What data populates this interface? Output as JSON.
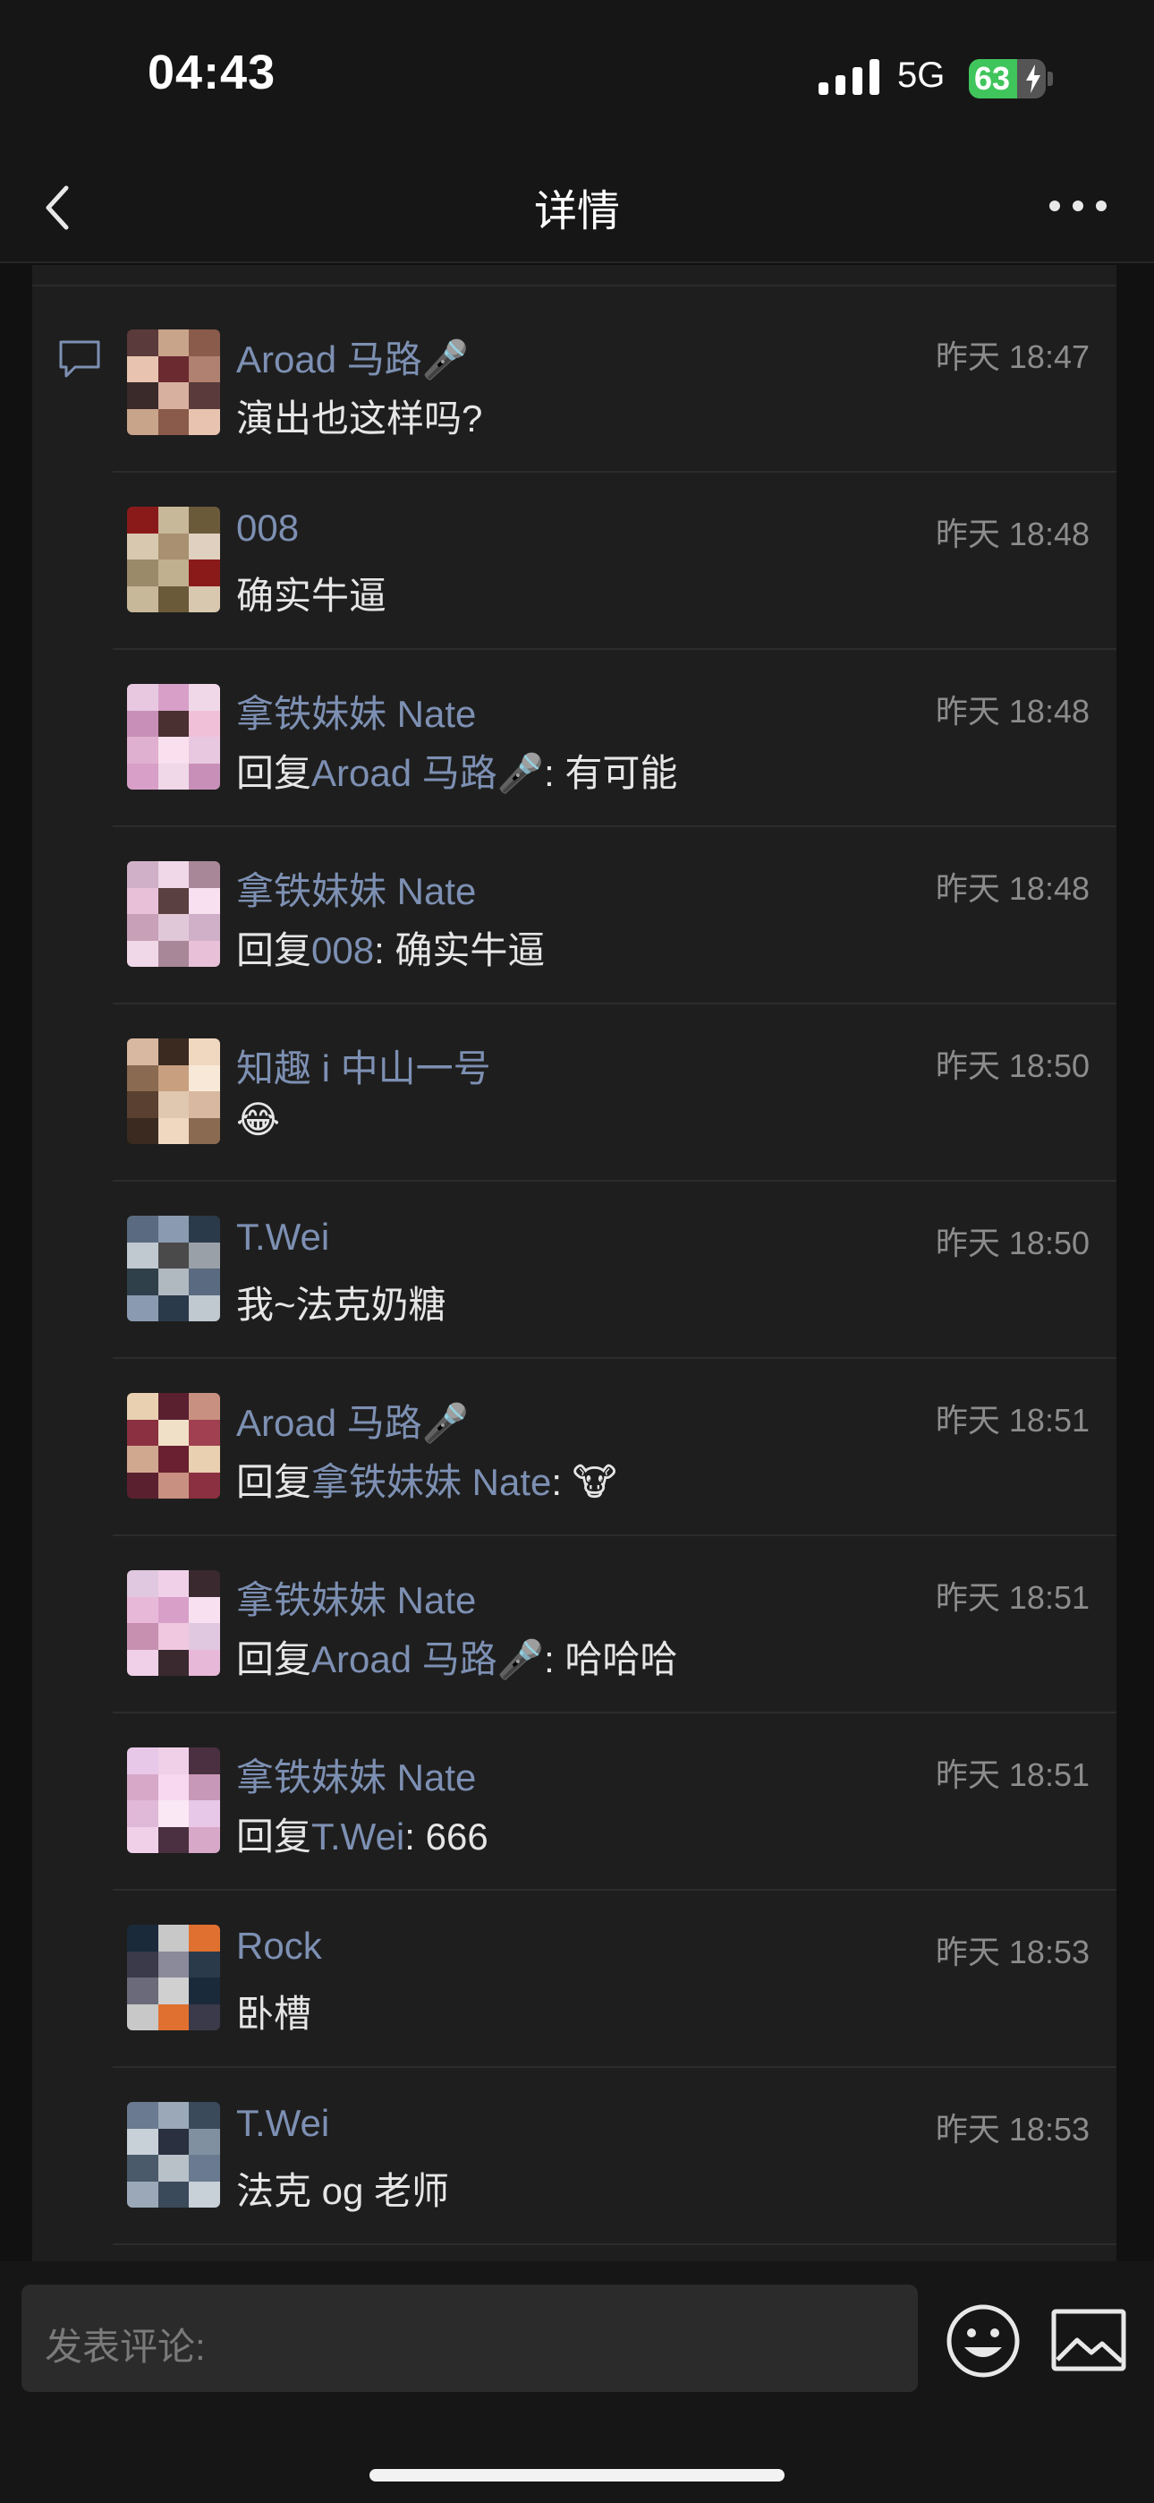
{
  "status_bar": {
    "time": "04:43",
    "network": "5G",
    "battery": "63",
    "battery_level": 0.63
  },
  "nav": {
    "title": "详情"
  },
  "comments": [
    {
      "name": "Aroad 马路🎤",
      "time": "昨天 18:47",
      "body": [
        {
          "t": "演出也这样吗?"
        }
      ]
    },
    {
      "name": "008",
      "time": "昨天 18:48",
      "body": [
        {
          "t": "确实牛逼"
        }
      ]
    },
    {
      "name": "拿铁妹妹 Nate",
      "time": "昨天 18:48",
      "body": [
        {
          "t": "回复"
        },
        {
          "t": "Aroad 马路🎤",
          "ref": true
        },
        {
          "t": ": 有可能"
        }
      ]
    },
    {
      "name": "拿铁妹妹 Nate",
      "time": "昨天 18:48",
      "body": [
        {
          "t": "回复"
        },
        {
          "t": "008",
          "ref": true
        },
        {
          "t": ": 确实牛逼"
        }
      ]
    },
    {
      "name": "知趣 i 中山一号",
      "time": "昨天 18:50",
      "body": [
        {
          "t": "😂"
        }
      ]
    },
    {
      "name": "T.Wei",
      "time": "昨天 18:50",
      "body": [
        {
          "t": "我~法克奶糖"
        }
      ]
    },
    {
      "name": "Aroad 马路🎤",
      "time": "昨天 18:51",
      "body": [
        {
          "t": "回复"
        },
        {
          "t": "拿铁妹妹 Nate",
          "ref": true
        },
        {
          "t": ": 🐮"
        }
      ]
    },
    {
      "name": "拿铁妹妹 Nate",
      "time": "昨天 18:51",
      "body": [
        {
          "t": "回复"
        },
        {
          "t": "Aroad 马路🎤",
          "ref": true
        },
        {
          "t": ": 哈哈哈"
        }
      ]
    },
    {
      "name": "拿铁妹妹 Nate",
      "time": "昨天 18:51",
      "body": [
        {
          "t": "回复"
        },
        {
          "t": "T.Wei",
          "ref": true
        },
        {
          "t": ": 666"
        }
      ]
    },
    {
      "name": "Rock",
      "time": "昨天 18:53",
      "body": [
        {
          "t": "卧槽"
        }
      ]
    },
    {
      "name": "T.Wei",
      "time": "昨天 18:53",
      "body": [
        {
          "t": "法克 og 老师"
        }
      ]
    }
  ],
  "avatar_palettes": [
    [
      "#5a3a3a",
      "#c8a48a",
      "#8a5a4a",
      "#e8c4b0",
      "#6a2a30",
      "#b08070",
      "#3a2a2a",
      "#d8b0a0"
    ],
    [
      "#8a1a1a",
      "#c8b89a",
      "#6a5a3a",
      "#d8c8b0",
      "#a89070",
      "#e0d0c0",
      "#9a8a6a",
      "#c0b090"
    ],
    [
      "#e8c8e0",
      "#d8a0c8",
      "#f0d8e8",
      "#c890b8",
      "#4a3030",
      "#f0c0d8",
      "#e0b0d0",
      "#fae0ee"
    ],
    [
      "#d0b0c8",
      "#f0d8e8",
      "#a88898",
      "#e8c0d8",
      "#5a4040",
      "#f8e0f0",
      "#c8a0b8",
      "#e0c8d8"
    ],
    [
      "#d8b8a0",
      "#3a2a20",
      "#f0d8c0",
      "#8a6a50",
      "#c8a080",
      "#f8e8d8",
      "#5a4030",
      "#e0c8b0"
    ],
    [
      "#5a6a80",
      "#8a9ab0",
      "#2a3a4a",
      "#c0c8d0",
      "#4a4a4a",
      "#9aa0a8",
      "#30404a",
      "#b0b8c0"
    ],
    [
      "#e8d0b0",
      "#5a2030",
      "#c89080",
      "#8a3040",
      "#f0e0c8",
      "#a04050",
      "#d0a890",
      "#6a2030"
    ],
    [
      "#e0c8e0",
      "#f0d0e8",
      "#3a2a30",
      "#e8b8d8",
      "#d8a0c8",
      "#f8e0f0",
      "#c890b0",
      "#f0c8e0"
    ],
    [
      "#e8c8e8",
      "#f0d0e8",
      "#4a3040",
      "#d8a8c8",
      "#f8d8f0",
      "#c898b8",
      "#e0b8d8",
      "#fae8f4"
    ],
    [
      "#1a2a3a",
      "#c8c8c8",
      "#e07030",
      "#3a3a4a",
      "#8a8a9a",
      "#2a3a4a",
      "#6a6a7a",
      "#d0d0d0"
    ],
    [
      "#6a7a90",
      "#9aa8b8",
      "#3a4a5a",
      "#c8d0d8",
      "#2a3040",
      "#8090a0",
      "#4a5a6a",
      "#b8c0c8"
    ]
  ],
  "input": {
    "placeholder": "发表评论:"
  }
}
